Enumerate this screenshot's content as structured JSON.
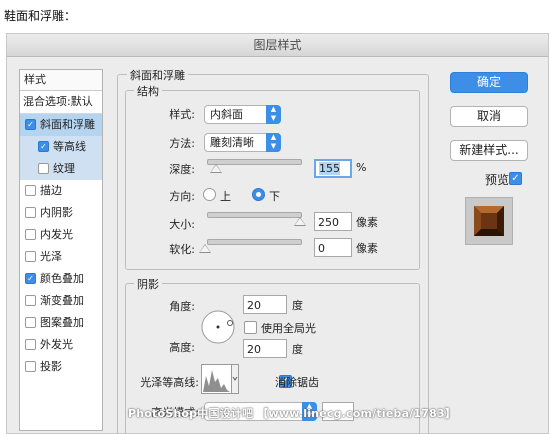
{
  "caption": "鞋面和浮雕：",
  "dialog": {
    "title": "图层样式",
    "list": {
      "header": "样式",
      "mixed": "混合选项:默认",
      "items": [
        {
          "label": "斜面和浮雕",
          "checked": true
        },
        {
          "label": "等高线",
          "checked": true
        },
        {
          "label": "纹理",
          "checked": false
        },
        {
          "label": "描边",
          "checked": false
        },
        {
          "label": "内阴影",
          "checked": false
        },
        {
          "label": "内发光",
          "checked": false
        },
        {
          "label": "光泽",
          "checked": false
        },
        {
          "label": "颜色叠加",
          "checked": true
        },
        {
          "label": "渐变叠加",
          "checked": false
        },
        {
          "label": "图案叠加",
          "checked": false
        },
        {
          "label": "外发光",
          "checked": false
        },
        {
          "label": "投影",
          "checked": false
        }
      ]
    },
    "bevel": {
      "section_title": "斜面和浮雕",
      "structure": {
        "title": "结构",
        "style_label": "样式:",
        "style_value": "内斜面",
        "method_label": "方法:",
        "method_value": "雕刻清晰",
        "depth_label": "深度:",
        "depth_value": "155",
        "depth_unit": "%",
        "direction_label": "方向:",
        "dir_up": "上",
        "dir_down": "下",
        "size_label": "大小:",
        "size_value": "250",
        "size_unit": "像素",
        "soften_label": "软化:",
        "soften_value": "0",
        "soften_unit": "像素"
      },
      "shading": {
        "title": "阴影",
        "angle_label": "角度:",
        "angle_value": "20",
        "angle_unit": "度",
        "global_light_label": "使用全局光",
        "altitude_label": "高度:",
        "altitude_value": "20",
        "altitude_unit": "度",
        "gloss_contour_label": "光泽等高线:",
        "antialias_label": "消除锯齿",
        "highlight_mode_label": "高光模式:"
      }
    },
    "buttons": {
      "ok": "确定",
      "cancel": "取消",
      "new_style": "新建样式...",
      "preview_label": "预览"
    }
  },
  "watermark": "PhotoShop中国设计吧 【www.linecg.com/tieba/1783】",
  "colors": {
    "accent": "#3d8ee6",
    "selected_row": "#b5d4f0",
    "preview_bronze": "#8a4a1c"
  }
}
